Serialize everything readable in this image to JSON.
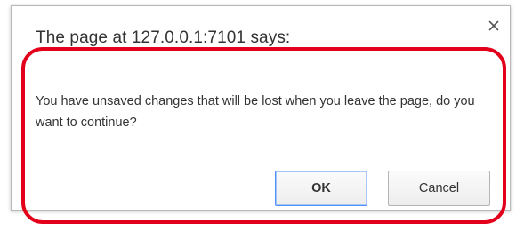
{
  "dialog": {
    "title": "The page at 127.0.0.1:7101 says:",
    "close_icon": "close-icon",
    "message": "You have unsaved changes that will be lost when you leave the page, do you want to continue?",
    "ok_label": "OK",
    "cancel_label": "Cancel"
  },
  "annotation": {
    "highlight_color": "#e3001b"
  },
  "colors": {
    "ok_border": "#4d90fe",
    "text": "#333333"
  }
}
